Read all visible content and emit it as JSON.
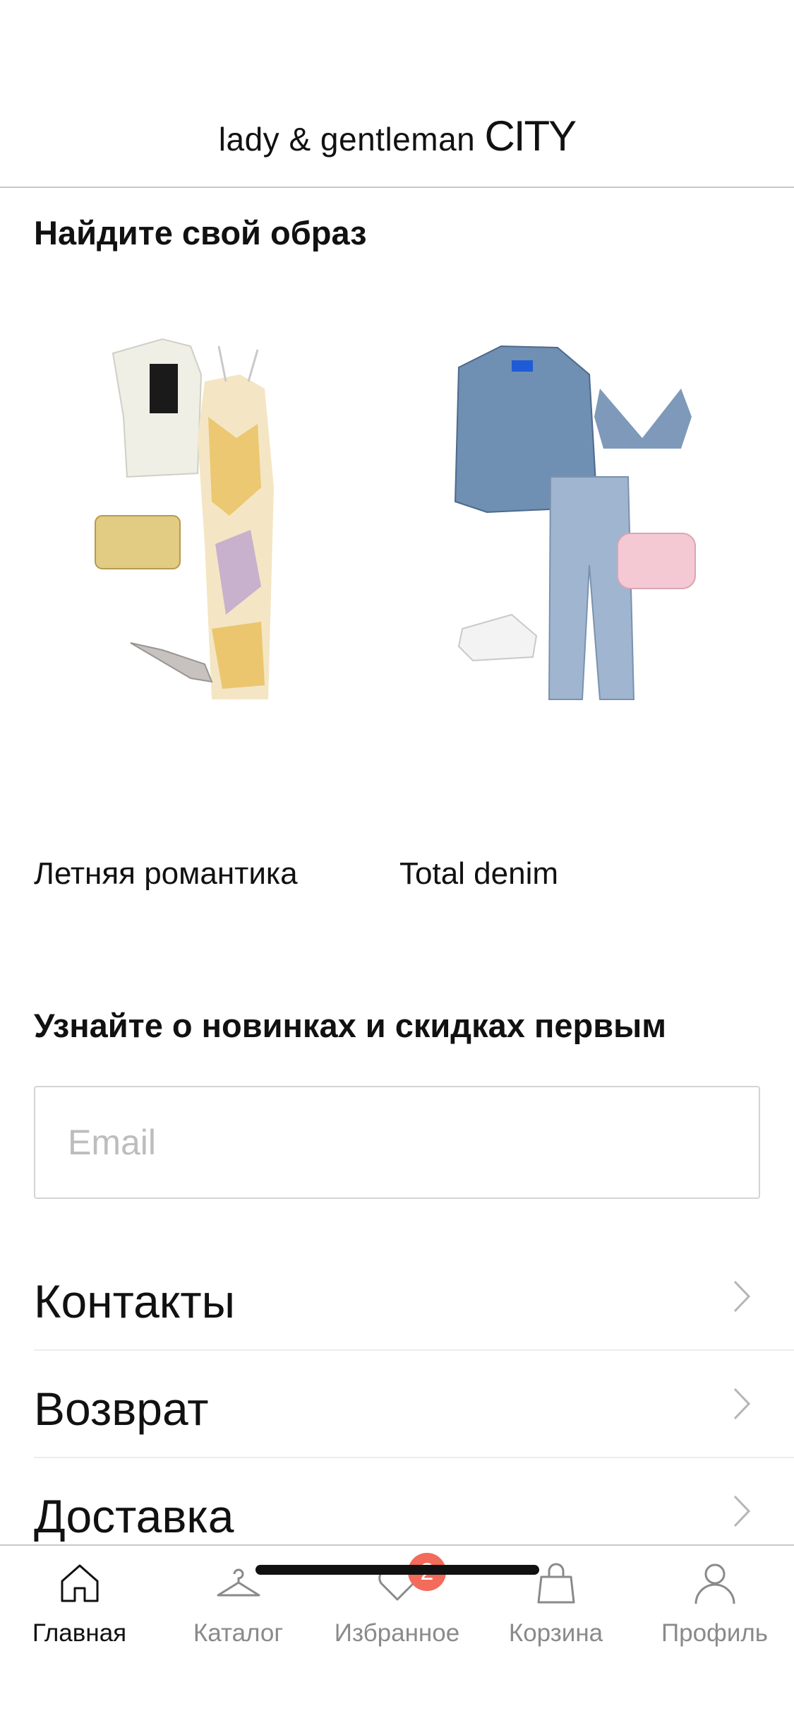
{
  "header": {
    "logo_text": "lady & gentleman",
    "logo_city": "CITY"
  },
  "looks": {
    "title": "Найдите свой образ",
    "items": [
      {
        "caption": "Летняя романтика"
      },
      {
        "caption": "Total denim"
      }
    ]
  },
  "newsletter": {
    "title": "Узнайте о новинках и скидках первым",
    "email_placeholder": "Email",
    "email_value": ""
  },
  "menu": {
    "items": [
      {
        "label": "Контакты",
        "icon": "chevron-right-icon"
      },
      {
        "label": "Возврат",
        "icon": "chevron-right-icon"
      },
      {
        "label": "Доставка",
        "icon": "chevron-right-icon"
      }
    ]
  },
  "tabbar": {
    "items": [
      {
        "label": "Главная",
        "icon": "home-icon",
        "active": true
      },
      {
        "label": "Каталог",
        "icon": "hanger-icon",
        "active": false
      },
      {
        "label": "Избранное",
        "icon": "heart-icon",
        "active": false,
        "badge": "2"
      },
      {
        "label": "Корзина",
        "icon": "bag-icon",
        "active": false
      },
      {
        "label": "Профиль",
        "icon": "user-icon",
        "active": false
      }
    ]
  },
  "colors": {
    "badge": "#f26b5b",
    "text": "#111111",
    "inactive": "#8a8a8a",
    "divider": "#c8c8c8"
  }
}
